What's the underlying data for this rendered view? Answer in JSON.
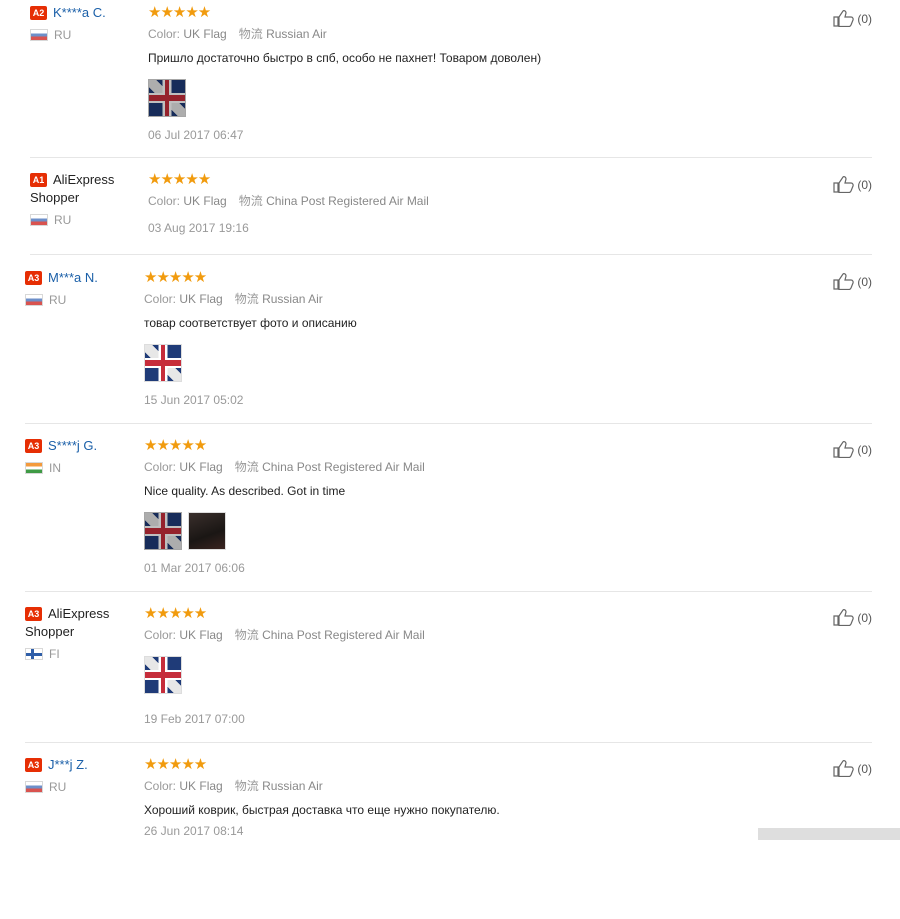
{
  "reviews": [
    {
      "level": "A2",
      "name": "K****a C.",
      "name_plain": false,
      "country": "RU",
      "flag": "ru",
      "stars": "★★★★★",
      "color_label": "Color:",
      "color_value": "UK Flag",
      "ship_label": "物流",
      "ship_value": "Russian Air",
      "comment": "Пришло достаточно быстро в спб, особо не пахнет! Товаром доволен)",
      "thumbs": [
        "uk uk-dark"
      ],
      "date": "06 Jul 2017 06:47",
      "likes": "(0)"
    },
    {
      "level": "A1",
      "name": "AliExpress Shopper",
      "name_plain": true,
      "country": "RU",
      "flag": "ru",
      "stars": "★★★★★",
      "color_label": "Color:",
      "color_value": "UK Flag",
      "ship_label": "物流",
      "ship_value": "China Post Registered Air Mail",
      "comment": "",
      "thumbs": [],
      "date": "03 Aug 2017 19:16",
      "likes": "(0)"
    },
    {
      "level": "A3",
      "name": "M***a N.",
      "name_plain": false,
      "country": "RU",
      "flag": "ru",
      "stars": "★★★★★",
      "color_label": "Color:",
      "color_value": "UK Flag",
      "ship_label": "物流",
      "ship_value": "Russian Air",
      "comment": "товар соответствует фото и описанию",
      "thumbs": [
        "uk"
      ],
      "date": "15 Jun 2017 05:02",
      "likes": "(0)"
    },
    {
      "level": "A3",
      "name": "S****j G.",
      "name_plain": false,
      "country": "IN",
      "flag": "in",
      "stars": "★★★★★",
      "color_label": "Color:",
      "color_value": "UK Flag",
      "ship_label": "物流",
      "ship_value": "China Post Registered Air Mail",
      "comment": "Nice quality. As described. Got in time",
      "thumbs": [
        "uk uk-dark",
        "plain-dark"
      ],
      "date": "01 Mar 2017 06:06",
      "likes": "(0)"
    },
    {
      "level": "A3",
      "name": "AliExpress Shopper",
      "name_plain": true,
      "country": "FI",
      "flag": "fi",
      "stars": "★★★★★",
      "color_label": "Color:",
      "color_value": "UK Flag",
      "ship_label": "物流",
      "ship_value": "China Post Registered Air Mail",
      "comment": "",
      "thumbs": [
        "uk"
      ],
      "date": "19 Feb 2017 07:00",
      "likes": "(0)"
    },
    {
      "level": "A3",
      "name": "J***j Z.",
      "name_plain": false,
      "country": "RU",
      "flag": "ru",
      "stars": "★★★★★",
      "color_label": "Color:",
      "color_value": "UK Flag",
      "ship_label": "物流",
      "ship_value": "Russian Air",
      "comment": "Хороший коврик, быстрая доставка что еще нужно покупателю.",
      "thumbs": [],
      "date": "26 Jun 2017 08:14",
      "likes": "(0)"
    }
  ]
}
